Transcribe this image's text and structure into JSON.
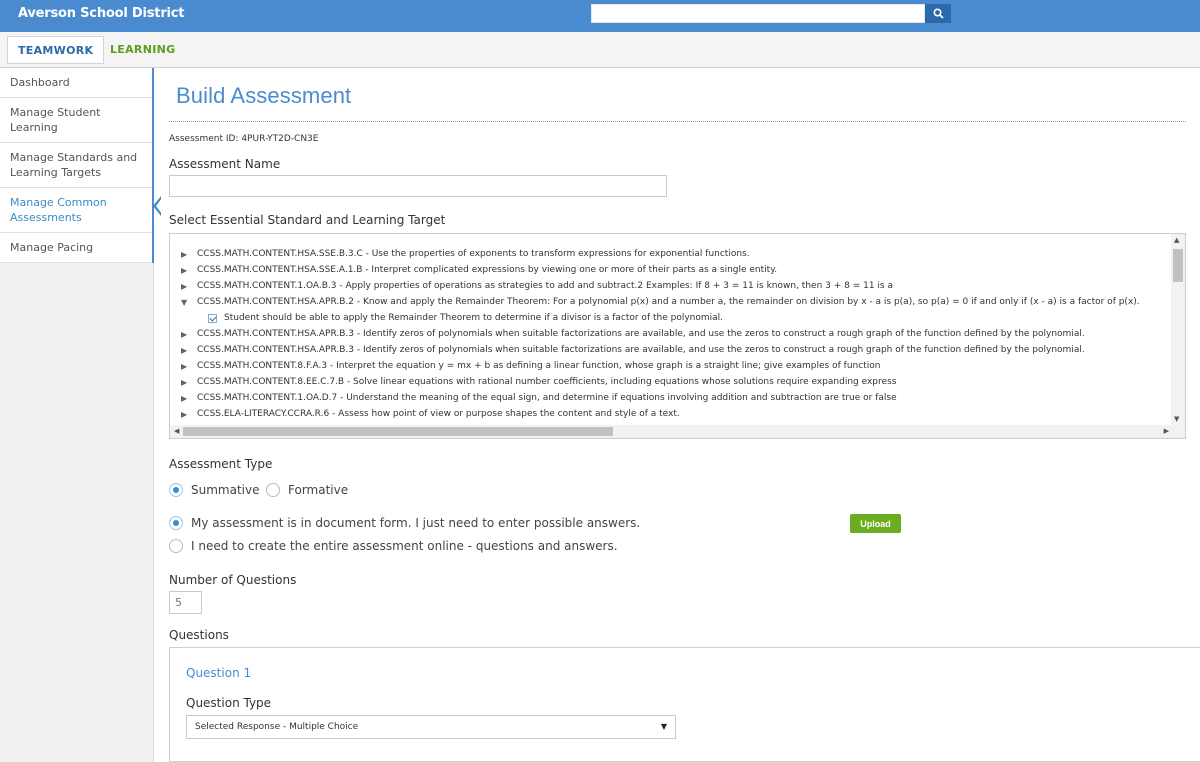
{
  "header": {
    "brand": "Averson School District",
    "search_placeholder": "",
    "search_value": ""
  },
  "nav": {
    "tabs": [
      {
        "label": "TEAMWORK"
      },
      {
        "label": "LEARNING"
      }
    ]
  },
  "sidebar": {
    "items": [
      {
        "label": "Dashboard"
      },
      {
        "label": "Manage Student Learning"
      },
      {
        "label": "Manage Standards and Learning Targets"
      },
      {
        "label": "Manage Common Assessments"
      },
      {
        "label": "Manage Pacing"
      }
    ],
    "active_index": 3
  },
  "main": {
    "title": "Build Assessment",
    "assessment_id": "Assessment ID: 4PUR-YT2D-CN3E",
    "name_label": "Assessment Name",
    "name_value": "",
    "standard_label": "Select Essential Standard and Learning Target",
    "standards": [
      {
        "text": "CCSS.MATH.CONTENT.HSA.SSE.B.3.C - Use the properties of exponents to transform expressions for exponential functions.",
        "expanded": false
      },
      {
        "text": "CCSS.MATH.CONTENT.HSA.SSE.A.1.B - Interpret complicated expressions by viewing one or more of their parts as a single entity.",
        "expanded": false
      },
      {
        "text": "CCSS.MATH.CONTENT.1.OA.B.3 - Apply properties of operations as strategies to add and subtract.2 Examples: If 8 + 3 = 11 is known, then 3 + 8 = 11 is a",
        "expanded": false
      },
      {
        "text": "CCSS.MATH.CONTENT.HSA.APR.B.2 - Know and apply the Remainder Theorem: For a polynomial p(x) and a number a, the remainder on division by x - a is p(a), so p(a) = 0 if and only if (x - a) is a factor of p(x).",
        "expanded": true
      },
      {
        "text": "Student should be able to apply the Remainder Theorem to determine if a divisor is a factor of the polynomial.",
        "child": true,
        "checked": true
      },
      {
        "text": "CCSS.MATH.CONTENT.HSA.APR.B.3 - Identify zeros of polynomials when suitable factorizations are available, and use the zeros to construct a rough graph of the function defined by the polynomial.",
        "expanded": false
      },
      {
        "text": "CCSS.MATH.CONTENT.HSA.APR.B.3 - Identify zeros of polynomials when suitable factorizations are available, and use the zeros to construct a rough graph of the function defined by the polynomial.",
        "expanded": false
      },
      {
        "text": "CCSS.MATH.CONTENT.8.F.A.3 - Interpret the equation y = mx + b as defining a linear function, whose graph is a straight line; give examples of function",
        "expanded": false
      },
      {
        "text": "CCSS.MATH.CONTENT.8.EE.C.7.B - Solve linear equations with rational number coefficients, including equations whose solutions require expanding express",
        "expanded": false
      },
      {
        "text": "CCSS.MATH.CONTENT.1.OA.D.7 - Understand the meaning of the equal sign, and determine if equations involving addition and subtraction are true or false",
        "expanded": false
      },
      {
        "text": "CCSS.ELA-LITERACY.CCRA.R.6 - Assess how point of view or purpose shapes the content and style of a text.",
        "expanded": false
      }
    ],
    "assessment_type_label": "Assessment Type",
    "type_summative": "Summative",
    "type_formative": "Formative",
    "form_option_document": "My assessment is in document form. I just need to enter possible answers.",
    "form_option_online": "I need to create the entire assessment online - questions and answers.",
    "upload_label": "Upload",
    "num_questions_label": "Number of Questions",
    "num_questions_value": "5",
    "questions_label": "Questions",
    "question": {
      "title": "Question 1",
      "type_label": "Question Type",
      "type_value": "Selected Response - Multiple Choice"
    }
  },
  "colors": {
    "header_blue": "#4a8bcf",
    "link_blue": "#3a8cc7",
    "learning_green": "#5e9c1c",
    "upload_green": "#6aad1f"
  }
}
